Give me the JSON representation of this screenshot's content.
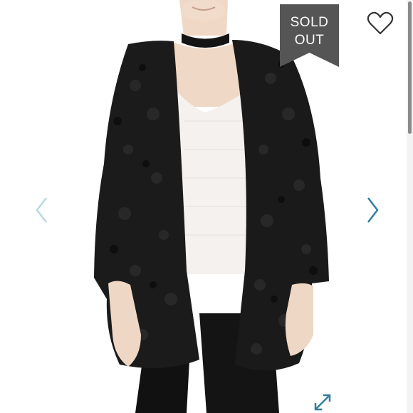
{
  "listing": {
    "status_badge": "SOLD\nOUT",
    "badge_color": "#555555",
    "accent_color": "#2f7fa0"
  },
  "icons": {
    "like": "heart-outline-icon",
    "previous": "chevron-left-icon",
    "next": "chevron-right-icon",
    "fullscreen": "expand-arrows-icon"
  }
}
